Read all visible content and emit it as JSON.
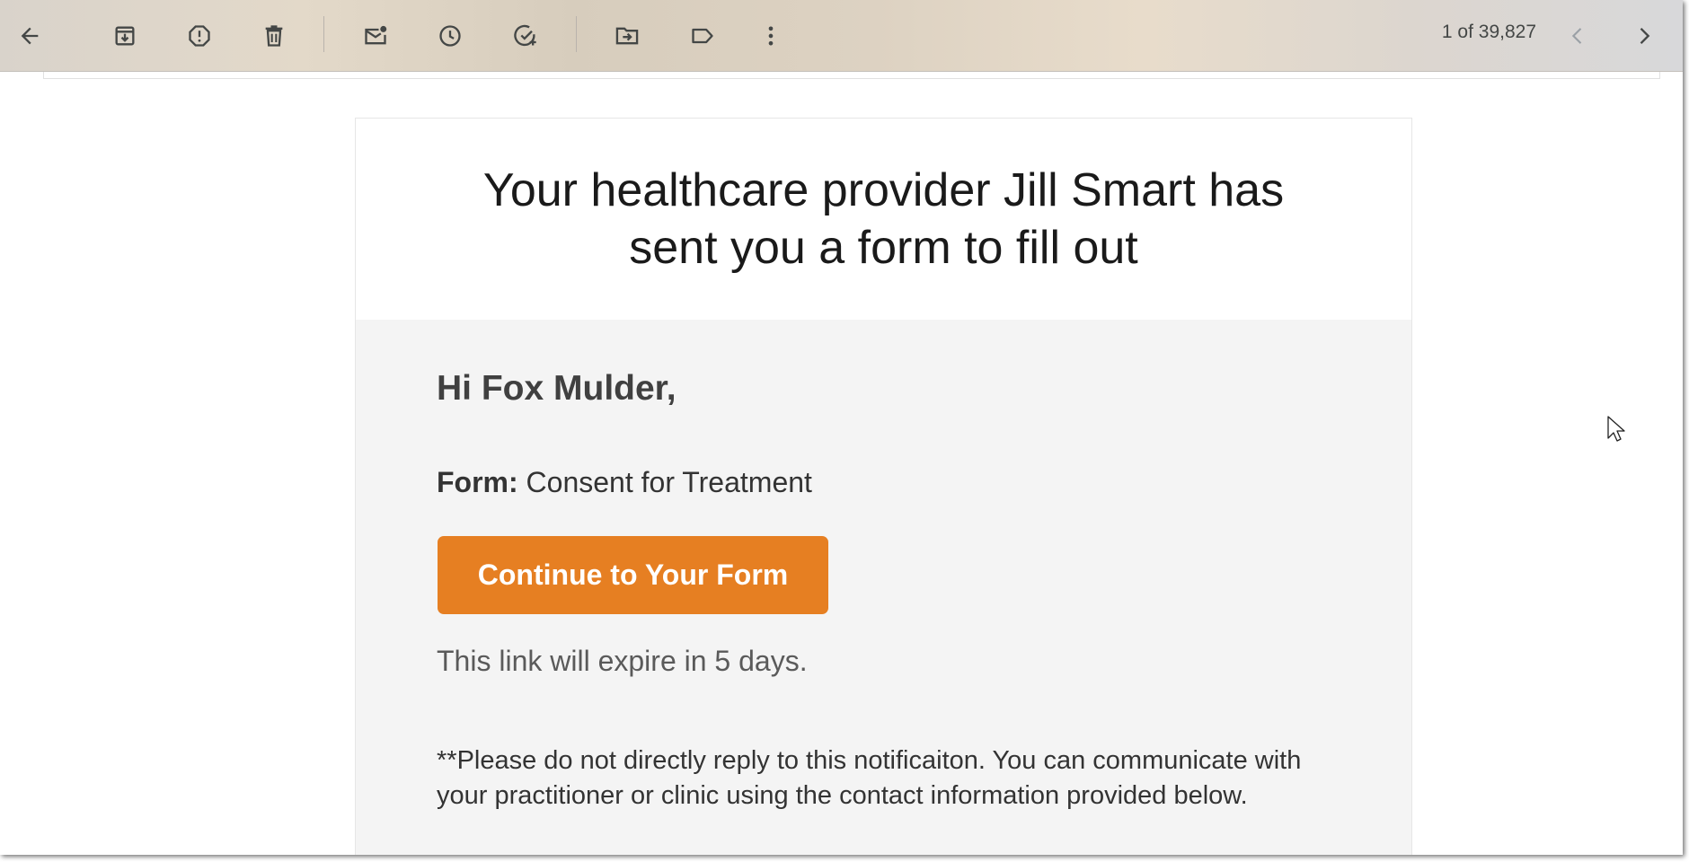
{
  "toolbar": {
    "icons": [
      "back-arrow-icon",
      "archive-icon",
      "report-spam-icon",
      "delete-icon",
      "mark-unread-icon",
      "snooze-icon",
      "add-task-icon",
      "move-to-icon",
      "label-icon",
      "more-vert-icon",
      "chevron-left-icon",
      "chevron-right-icon"
    ],
    "pager_text": "1 of 39,827"
  },
  "email": {
    "title": "Your healthcare provider Jill Smart has sent you a form to fill out",
    "greeting": "Hi Fox Mulder,",
    "form_label": "Form:",
    "form_name": "Consent for Treatment",
    "cta_label": "Continue to Your Form",
    "expire_text": "This link will expire in 5 days.",
    "note": "**Please do not directly reply to this notificaiton. You can communicate with your practitioner or clinic using the contact information provided below."
  },
  "colors": {
    "cta_background": "#e67f22",
    "card_body_background": "#f4f4f4",
    "icon_color": "#444746"
  }
}
